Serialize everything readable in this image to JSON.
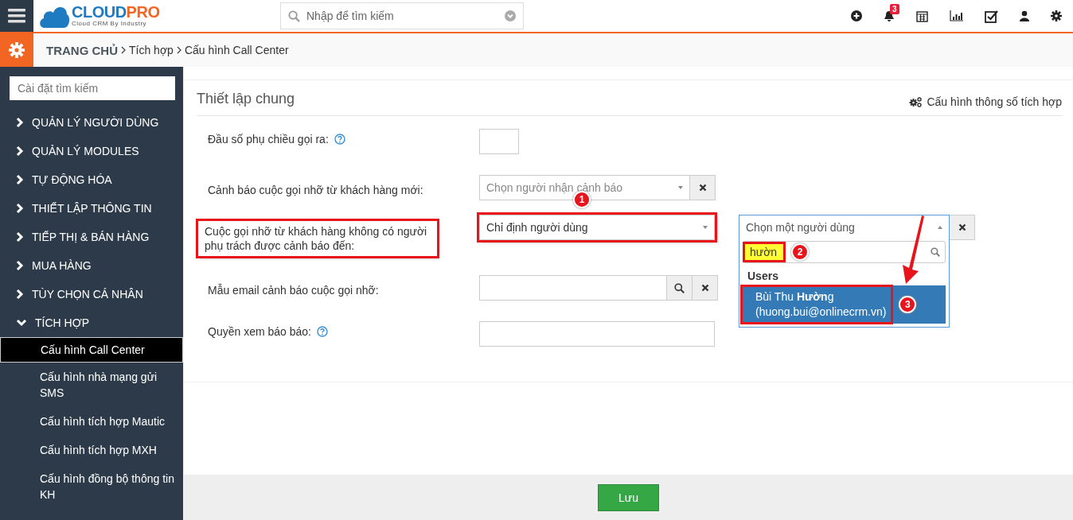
{
  "logo": {
    "brand_part1": "CLOUD",
    "brand_part2": "PRO",
    "tagline": "Cloud CRM By Industry"
  },
  "topbar": {
    "search_placeholder": "Nhập để tìm kiếm",
    "notification_count": "3"
  },
  "breadcrumb": [
    "TRANG CHỦ",
    "Tích hợp",
    "Cấu hình Call Center"
  ],
  "sidebar": {
    "search_placeholder": "Cài đặt tìm kiếm",
    "items": [
      {
        "label": "QUẢN LÝ NGƯỜI DÙNG",
        "expanded": false
      },
      {
        "label": "QUẢN LÝ MODULES",
        "expanded": false
      },
      {
        "label": "TỰ ĐỘNG HÓA",
        "expanded": false
      },
      {
        "label": "THIẾT LẬP THÔNG TIN",
        "expanded": false
      },
      {
        "label": "TIẾP THỊ & BÁN HÀNG",
        "expanded": false
      },
      {
        "label": "MUA HÀNG",
        "expanded": false
      },
      {
        "label": "TÙY CHỌN CÁ NHÂN",
        "expanded": false
      },
      {
        "label": "TÍCH HỢP",
        "expanded": true,
        "children": [
          {
            "label": "Cấu hình Call Center",
            "selected": true
          },
          {
            "label": "Cấu hình nhà mạng gửi SMS",
            "selected": false
          },
          {
            "label": "Cấu hình tích hợp Mautic",
            "selected": false
          },
          {
            "label": "Cấu hình tích hợp MXH",
            "selected": false
          },
          {
            "label": "Cấu hình đồng bộ thông tin KH",
            "selected": false
          }
        ]
      }
    ]
  },
  "panel": {
    "title": "Thiết lập chung",
    "config_link": "Cấu hình thông số tích hợp"
  },
  "fields": [
    {
      "kind": "short-input",
      "label": "Đầu số phụ chiều gọi ra:",
      "help": true,
      "highlighted": false
    },
    {
      "kind": "select-clear",
      "label": "Cảnh báo cuộc gọi nhỡ từ khách hàng mới:",
      "help": false,
      "highlighted": false,
      "placeholder": "Chọn người nhận cảnh báo"
    },
    {
      "kind": "select",
      "label": "Cuộc gọi nhỡ từ khách hàng không có người phụ trách được cảnh báo đến:",
      "help": false,
      "highlighted": true,
      "value": "Chỉ định người dùng",
      "marker": "1"
    },
    {
      "kind": "lookup",
      "label": "Mẫu email cảnh báo cuộc gọi nhỡ:",
      "help": false,
      "highlighted": false
    },
    {
      "kind": "input",
      "label": "Quyền xem báo báo:",
      "help": true,
      "highlighted": false
    }
  ],
  "user_picker": {
    "placeholder": "Chọn một người dùng",
    "open": true,
    "search_value": "hườn",
    "search_marker": "2",
    "group": "Users",
    "options": [
      {
        "name": "Bùi Thu **Hườn**g",
        "email": "(huong.bui@onlinecrm.vn)",
        "selected": true,
        "marker": "3"
      }
    ]
  },
  "save_button": "Lưu"
}
